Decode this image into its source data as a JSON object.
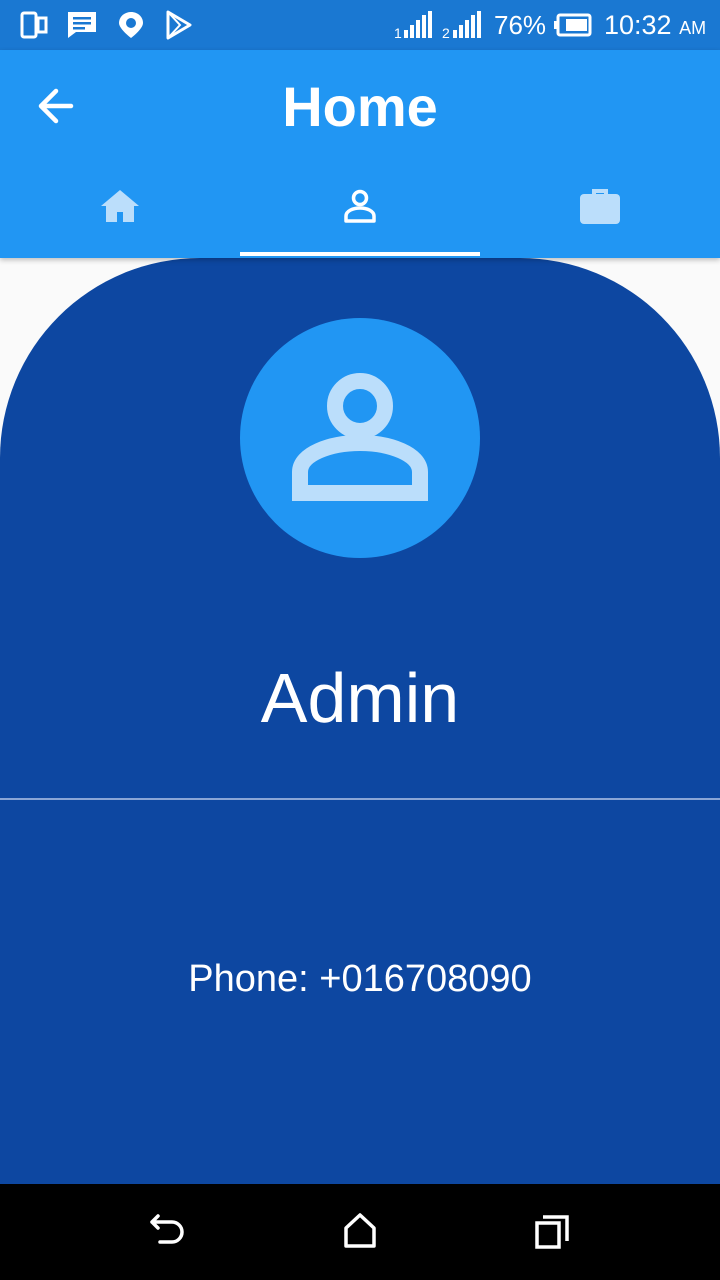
{
  "status_bar": {
    "icons": [
      "phone-screen-icon",
      "message-icon",
      "location-pin-icon",
      "play-store-icon",
      "sim1-signal-icon",
      "sim2-signal-icon",
      "battery-icon"
    ],
    "battery_percent": "76%",
    "time": "10:32",
    "ampm": "AM"
  },
  "app_bar": {
    "title": "Home",
    "tabs": [
      {
        "icon": "home-icon",
        "selected": false
      },
      {
        "icon": "person-icon",
        "selected": true
      },
      {
        "icon": "briefcase-icon",
        "selected": false
      }
    ]
  },
  "profile": {
    "name": "Admin",
    "phone": "Phone: +016708090"
  },
  "nav_bar": {
    "buttons": [
      "back-nav-icon",
      "home-nav-icon",
      "recents-nav-icon"
    ]
  },
  "colors": {
    "status_bar": "#1a78d2",
    "app_bar": "#2196f3",
    "card": "#0d47a1",
    "icon_light": "#bbdefb"
  }
}
